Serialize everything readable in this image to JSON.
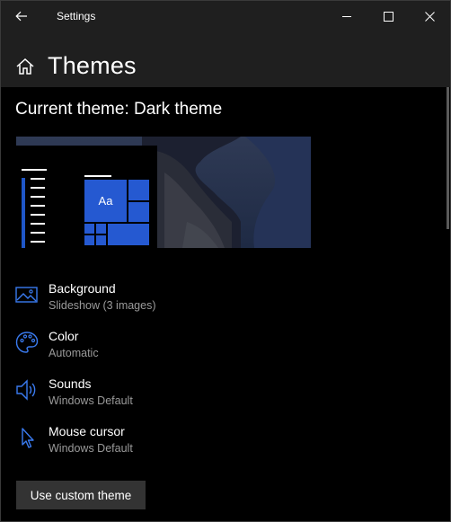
{
  "window": {
    "title": "Settings"
  },
  "header": {
    "title": "Themes"
  },
  "current_theme": {
    "label": "Current theme: Dark theme"
  },
  "preview": {
    "sample_text": "Aa"
  },
  "items": [
    {
      "name": "Background",
      "value": "Slideshow (3 images)",
      "icon": "picture-icon"
    },
    {
      "name": "Color",
      "value": "Automatic",
      "icon": "palette-icon"
    },
    {
      "name": "Sounds",
      "value": "Windows Default",
      "icon": "speaker-icon"
    },
    {
      "name": "Mouse cursor",
      "value": "Windows Default",
      "icon": "cursor-icon"
    }
  ],
  "actions": {
    "custom_button": "Use custom theme"
  },
  "colors": {
    "accent": "#2559d1",
    "titlebar": "#1f1f1f",
    "background": "#000000",
    "secondary_text": "#9a9a9a"
  }
}
